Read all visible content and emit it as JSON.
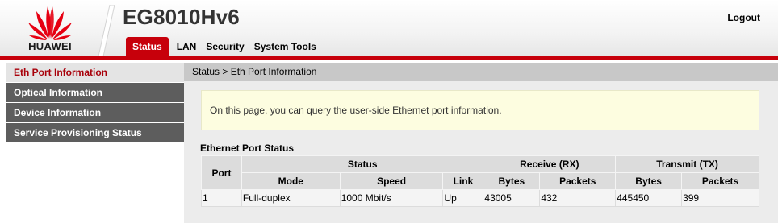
{
  "brand": {
    "logo_text": "HUAWEI",
    "accent_color": "#c7000b"
  },
  "header": {
    "product_name": "EG8010Hv6",
    "logout_label": "Logout"
  },
  "nav": {
    "items": [
      {
        "label": "Status",
        "active": true
      },
      {
        "label": "LAN"
      },
      {
        "label": "Security"
      },
      {
        "label": "System Tools"
      }
    ]
  },
  "sidebar": {
    "items": [
      {
        "label": "Eth Port Information",
        "active": true
      },
      {
        "label": "Optical Information"
      },
      {
        "label": "Device Information"
      },
      {
        "label": "Service Provisioning Status"
      }
    ]
  },
  "main": {
    "breadcrumb": "Status > Eth Port Information",
    "notice": "On this page, you can query the user-side Ethernet port information.",
    "section_title": "Ethernet Port Status",
    "table": {
      "group_headers": {
        "port": "Port",
        "status": "Status",
        "receive": "Receive (RX)",
        "transmit": "Transmit (TX)"
      },
      "sub_headers": {
        "mode": "Mode",
        "speed": "Speed",
        "link": "Link",
        "rx_bytes": "Bytes",
        "rx_packets": "Packets",
        "tx_bytes": "Bytes",
        "tx_packets": "Packets"
      },
      "rows": [
        {
          "port": "1",
          "mode": "Full-duplex",
          "speed": "1000 Mbit/s",
          "link": "Up",
          "rx_bytes": "43005",
          "rx_packets": "432",
          "tx_bytes": "445450",
          "tx_packets": "399"
        }
      ]
    }
  }
}
